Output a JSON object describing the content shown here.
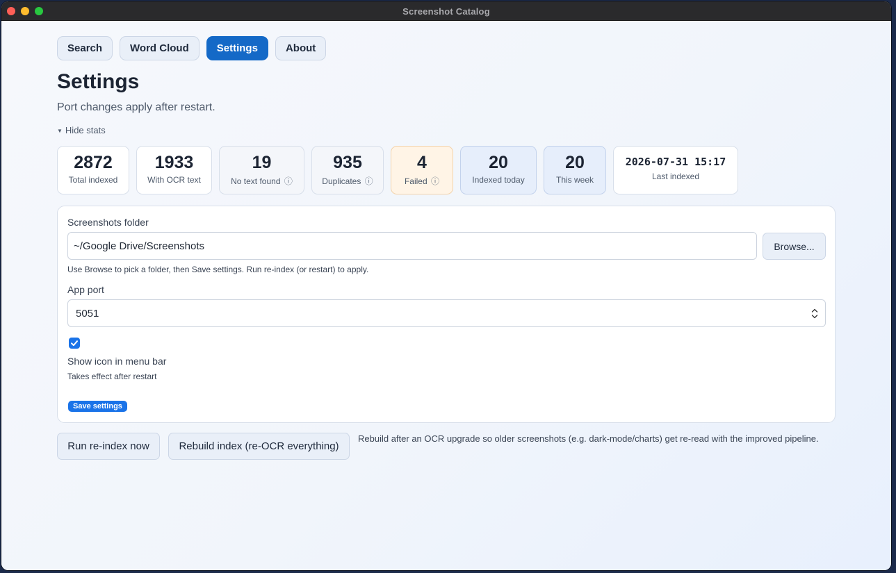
{
  "window": {
    "title": "Screenshot Catalog"
  },
  "tabs": [
    {
      "label": "Search",
      "active": false
    },
    {
      "label": "Word Cloud",
      "active": false
    },
    {
      "label": "Settings",
      "active": true
    },
    {
      "label": "About",
      "active": false
    }
  ],
  "page": {
    "title": "Settings",
    "subtitle": "Port changes apply after restart.",
    "toggle_stats": "Hide stats"
  },
  "stats": [
    {
      "value": "2872",
      "label": "Total indexed"
    },
    {
      "value": "1933",
      "label": "With OCR text"
    },
    {
      "value": "19",
      "label": "No text found",
      "info": "ⓘ"
    },
    {
      "value": "935",
      "label": "Duplicates",
      "info": "ⓘ"
    },
    {
      "value": "4",
      "label": "Failed",
      "info": "ⓘ"
    },
    {
      "value": "20",
      "label": "Indexed today"
    },
    {
      "value": "20",
      "label": "This week"
    },
    {
      "value": "2026-07-31 15:17",
      "label": "Last indexed"
    }
  ],
  "settings": {
    "folder_label": "Screenshots folder",
    "folder_value": "~/Google Drive/Screenshots",
    "browse_label": "Browse...",
    "folder_hint": "Use Browse to pick a folder, then Save settings. Run re-index (or restart) to apply.",
    "port_label": "App port",
    "port_value": "5051",
    "menu_bar_checked": true,
    "menu_bar_label": "Show icon in menu bar",
    "menu_bar_hint": "Takes effect after restart",
    "save_label": "Save settings"
  },
  "actions": {
    "reindex_label": "Run re-index now",
    "rebuild_label": "Rebuild index (re-OCR everything)",
    "rebuild_note": "Rebuild after an OCR upgrade so older screenshots (e.g. dark-mode/charts) get re-read with the improved pipeline."
  },
  "colors": {
    "accent": "#1469c7",
    "checkbox": "#1a73e8",
    "failed_bg": "#fff4e6",
    "highlight_bg": "#e6eefb"
  }
}
